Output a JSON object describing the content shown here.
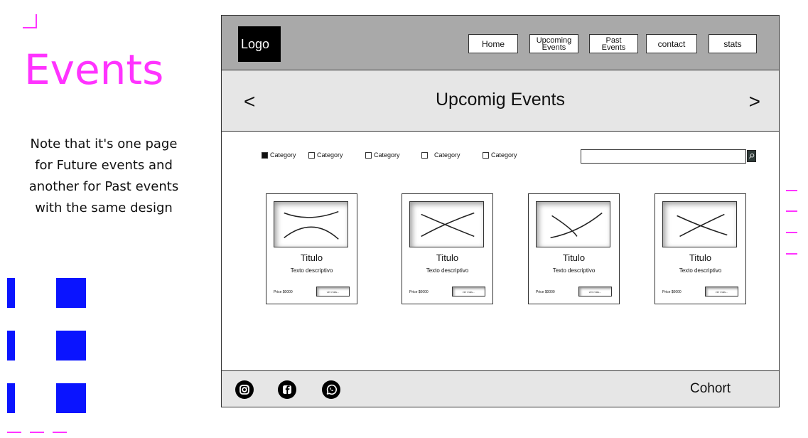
{
  "slide": {
    "title": "Events",
    "note": "Note that it's one page for Future events and another for Past events with the same design"
  },
  "wireframe": {
    "logo": "Logo",
    "nav": [
      {
        "label": "Home"
      },
      {
        "label": "Upcoming\nEvents"
      },
      {
        "label": "Past\nEvents"
      },
      {
        "label": "contact"
      },
      {
        "label": "stats"
      }
    ],
    "hero": {
      "title": "Upcomig Events",
      "prev": "<",
      "next": ">"
    },
    "categories": [
      {
        "label": "Category",
        "checked": true
      },
      {
        "label": "Category",
        "checked": false
      },
      {
        "label": "Category",
        "checked": false
      },
      {
        "label": "Category",
        "checked": false
      },
      {
        "label": "Category",
        "checked": false
      }
    ],
    "search": {
      "placeholder": "",
      "icon": "search-icon"
    },
    "cards": [
      {
        "title": "Titulo",
        "text": "Texto descriptivo",
        "price": "Price $0000",
        "button": "ver más..."
      },
      {
        "title": "Titulo",
        "text": "Texto descriptivo",
        "price": "Price $0000",
        "button": "ver más..."
      },
      {
        "title": "Titulo",
        "text": "Texto descriptivo",
        "price": "Price $0000",
        "button": "ver más..."
      },
      {
        "title": "Titulo",
        "text": "Texto descriptivo",
        "price": "Price $0000",
        "button": "ver más..."
      }
    ],
    "footer": {
      "social_icons": [
        "instagram-icon",
        "facebook-icon",
        "whatsapp-icon"
      ],
      "text": "Cohort"
    }
  },
  "colors": {
    "accent_magenta": "#ff33ff",
    "accent_blue": "#0a14ff",
    "header_gray": "#a9a9a9",
    "band_gray": "#e6e6e6"
  }
}
